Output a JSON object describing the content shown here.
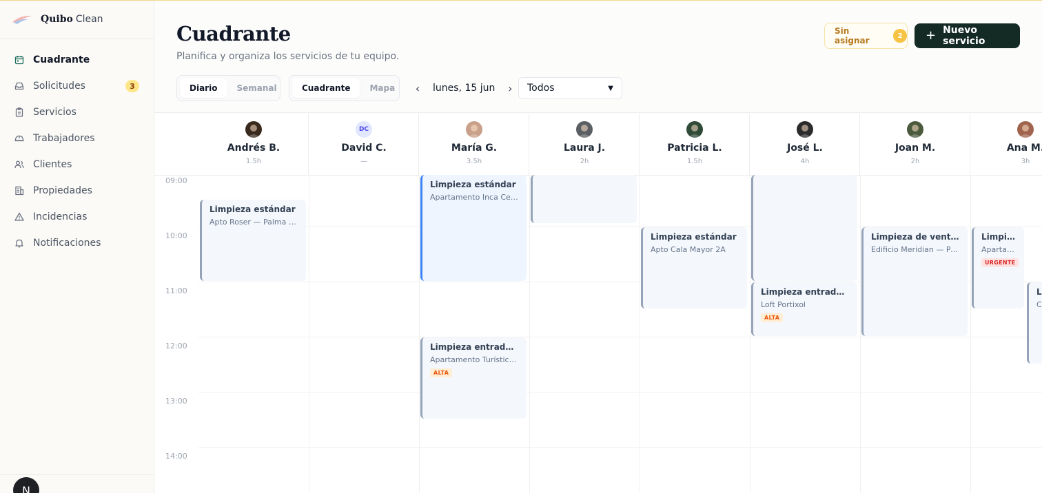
{
  "brand": {
    "name": "Quibo",
    "sub": "Clean"
  },
  "sidebar": {
    "items": [
      {
        "label": "Cuadrante",
        "icon": "calendar-icon",
        "active": true
      },
      {
        "label": "Solicitudes",
        "icon": "inbox-icon",
        "badge": "3"
      },
      {
        "label": "Servicios",
        "icon": "clipboard-icon"
      },
      {
        "label": "Trabajadores",
        "icon": "helmet-icon"
      },
      {
        "label": "Clientes",
        "icon": "users-icon"
      },
      {
        "label": "Propiedades",
        "icon": "building-icon"
      },
      {
        "label": "Incidencias",
        "icon": "warning-icon"
      },
      {
        "label": "Notificaciones",
        "icon": "bell-icon"
      }
    ],
    "user": {
      "initial": "N"
    }
  },
  "header": {
    "title": "Cuadrante",
    "subtitle": "Planifica y organiza los servicios de tu equipo.",
    "unassigned_label": "Sin asignar",
    "unassigned_count": "2",
    "new_service_label": "Nuevo servicio",
    "view_modes": [
      "Diario",
      "Semanal"
    ],
    "display_modes": [
      "Cuadrante",
      "Mapa"
    ],
    "date_label": "lunes, 15 jun",
    "filter_value": "Todos"
  },
  "time_labels": [
    "09:00",
    "10:00",
    "11:00",
    "12:00",
    "13:00",
    "14:00"
  ],
  "workers": [
    {
      "name": "Andrés B.",
      "hours": "1.5h",
      "avatar_color": "#3a2a1e"
    },
    {
      "name": "David C.",
      "hours": "—",
      "initials": "DC"
    },
    {
      "name": "María G.",
      "hours": "3.5h",
      "avatar_color": "#c9a08a"
    },
    {
      "name": "Laura J.",
      "hours": "2h",
      "avatar_color": "#5b5f63"
    },
    {
      "name": "Patricia L.",
      "hours": "1.5h",
      "avatar_color": "#2f4a36"
    },
    {
      "name": "José L.",
      "hours": "4h",
      "avatar_color": "#2b2b2b"
    },
    {
      "name": "Joan M.",
      "hours": "2h",
      "avatar_color": "#4a5a3c"
    },
    {
      "name": "Ana M.",
      "hours": "3h",
      "avatar_color": "#a0644e"
    }
  ],
  "events": [
    {
      "col": 0,
      "start": 9.5,
      "end": 11.0,
      "title": "Limpieza estándar",
      "sub": "Apto Roser — Palma centro",
      "color": "gray"
    },
    {
      "col": 2,
      "start": 8.9,
      "end": 11.0,
      "title": "Limpieza estándar",
      "sub": "Apartamento Inca Centro",
      "color": "blue"
    },
    {
      "col": 2,
      "start": 12.0,
      "end": 13.5,
      "title": "Limpieza entrada/salida",
      "sub": "Apartamento Turístico Llevant",
      "tag": "ALTA",
      "color": "gray"
    },
    {
      "col": 3,
      "start": 8.9,
      "end": 9.95,
      "title": "",
      "sub": "",
      "color": "gray"
    },
    {
      "col": 4,
      "start": 10.0,
      "end": 11.5,
      "title": "Limpieza estándar",
      "sub": "Apto Cala Mayor 2A",
      "color": "gray"
    },
    {
      "col": 5,
      "start": 8.9,
      "end": 11.0,
      "title": "",
      "sub": "",
      "color": "gray"
    },
    {
      "col": 5,
      "start": 11.0,
      "end": 12.0,
      "title": "Limpieza entrada/salida",
      "sub": "Loft Portixol",
      "tag": "ALTA",
      "color": "gray"
    },
    {
      "col": 6,
      "start": 10.0,
      "end": 12.0,
      "title": "Limpieza de ventanas",
      "sub": "Edificio Meridian — Portixol",
      "color": "gray"
    },
    {
      "col": 7,
      "start": 10.0,
      "end": 11.5,
      "title": "Limpieza estándar",
      "sub": "Apartamento",
      "tag": "URGENTE",
      "color": "gray",
      "narrow": true
    },
    {
      "col": 7.5,
      "start": 11.0,
      "end": 12.5,
      "title": "Limpieza",
      "sub": "Casa",
      "color": "gray",
      "narrow": true
    }
  ]
}
